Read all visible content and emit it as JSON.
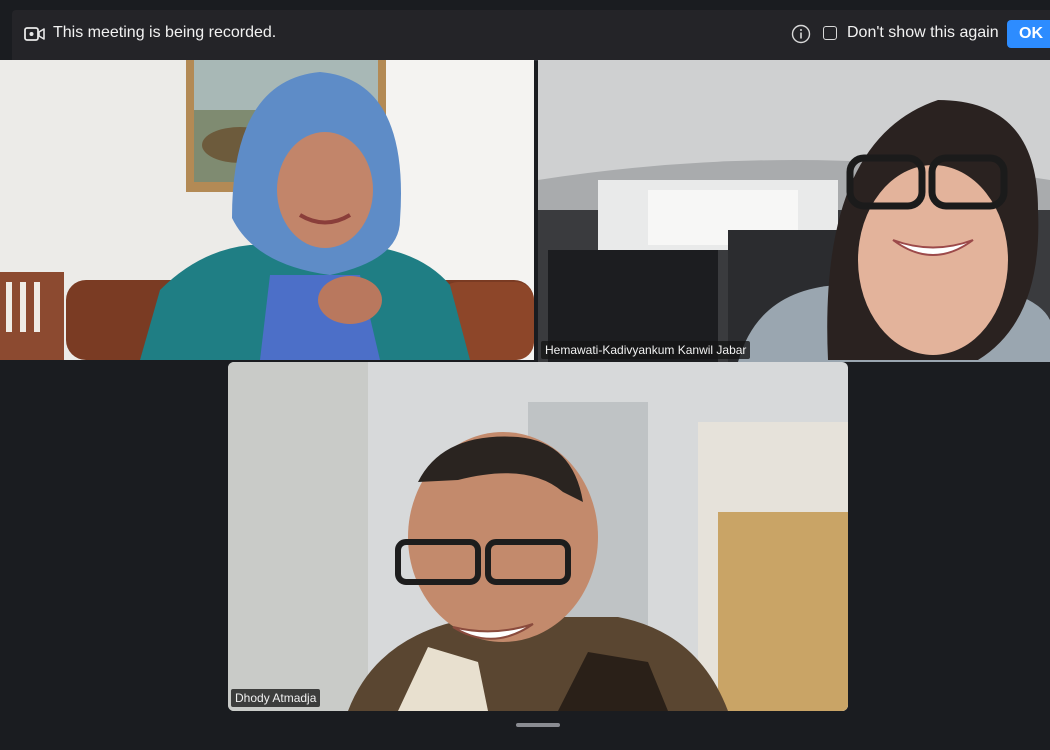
{
  "banner": {
    "recording_text": "This meeting is being recorded.",
    "checkbox_label": "Don't show this again",
    "ok_label": "OK"
  },
  "participants": [
    {
      "name": ""
    },
    {
      "name": "Hemawati-Kadivyankum Kanwil Jabar",
      "active_speaker": true
    },
    {
      "name": "Dhody Atmadja"
    }
  ],
  "colors": {
    "background": "#1a1c20",
    "banner": "#242428",
    "ok_button": "#2d8cff",
    "active_speaker_border": "#3ee07a"
  }
}
